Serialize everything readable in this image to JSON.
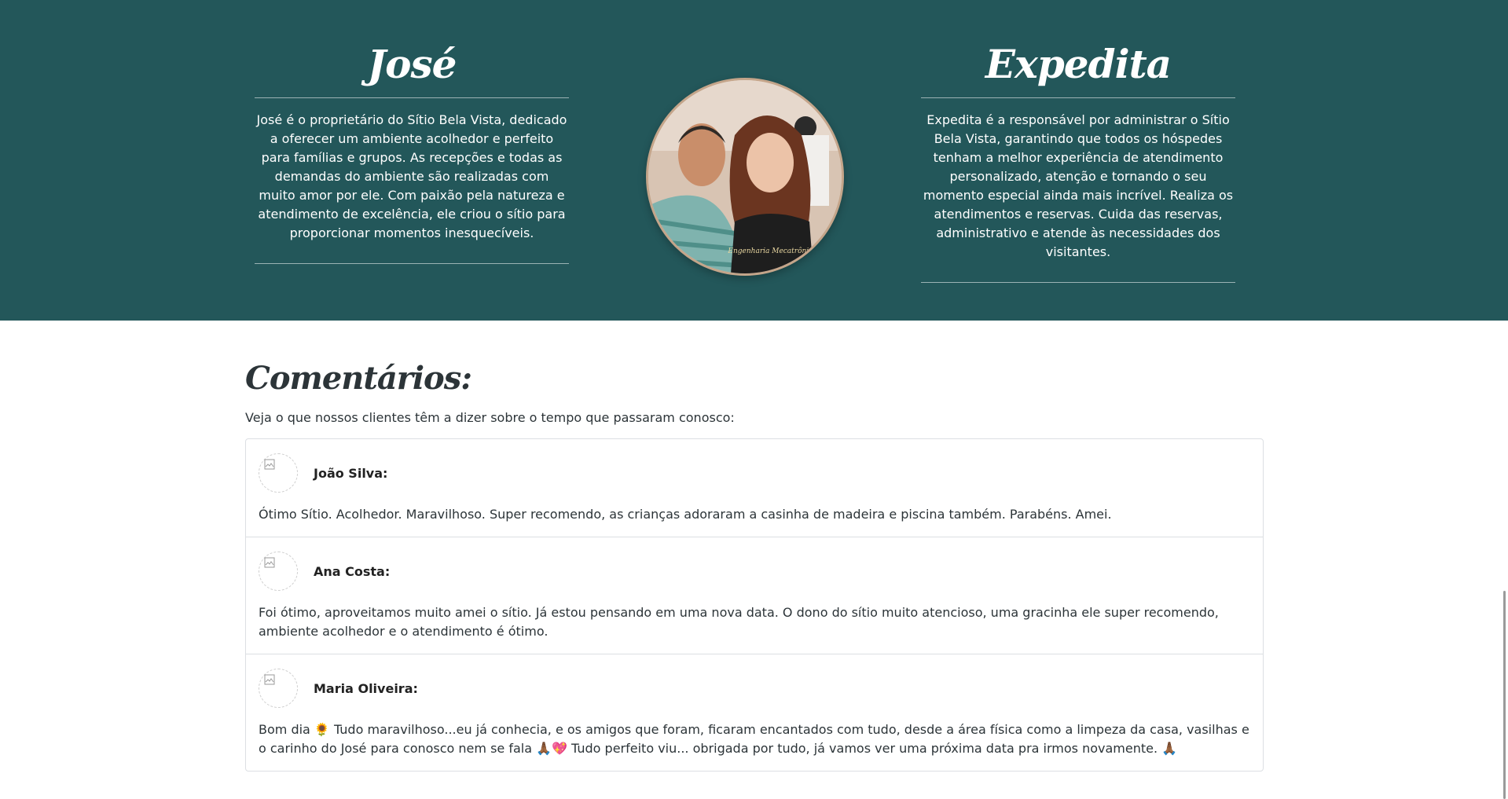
{
  "owners": {
    "left": {
      "name": "José",
      "description": "José é o proprietário do Sítio Bela Vista, dedicado a oferecer um ambiente acolhedor e perfeito para famílias e grupos. As recepções e todas as demandas do ambiente são realizadas com muito amor por ele. Com paixão pela natureza e atendimento de excelência, ele criou o sítio para proporcionar momentos inesquecíveis."
    },
    "right": {
      "name": "Expedita",
      "description": "Expedita é a responsável por administrar o Sítio Bela Vista, garantindo que todos os hóspedes tenham a melhor experiência de atendimento personalizado, atenção e tornando o seu momento especial ainda mais incrível. Realiza os atendimentos e reservas. Cuida das reservas, administrativo e atende às necessidades dos visitantes."
    },
    "photo_shirt_text": "Engenharia Mecatrônica"
  },
  "comments_section": {
    "title": "Comentários:",
    "intro": "Veja o que nossos clientes têm a dizer sobre o tempo que passaram conosco:",
    "items": [
      {
        "author": "João Silva:",
        "text": "Ótimo Sítio. Acolhedor. Maravilhoso. Super recomendo, as crianças adoraram a casinha de madeira e piscina também. Parabéns. Amei."
      },
      {
        "author": "Ana Costa:",
        "text": "Foi ótimo, aproveitamos muito amei o sítio. Já estou pensando em uma nova data. O dono do sítio muito atencioso, uma gracinha ele super recomendo, ambiente acolhedor e o atendimento é ótimo."
      },
      {
        "author": "Maria Oliveira:",
        "text": "Bom dia 🌻 Tudo maravilhoso...eu já conhecia, e os amigos que foram, ficaram encantados com tudo, desde a área física como a limpeza da casa, vasilhas e o carinho do José para conosco nem se fala 🙏🏾💖 Tudo perfeito viu... obrigada por tudo, já vamos ver uma próxima data pra irmos novamente. 🙏🏾"
      }
    ]
  },
  "colors": {
    "hero_bg": "#23575a",
    "photo_border": "#c4a58a",
    "text_dark": "#2c3438"
  },
  "icons": [
    "broken-image-icon"
  ]
}
